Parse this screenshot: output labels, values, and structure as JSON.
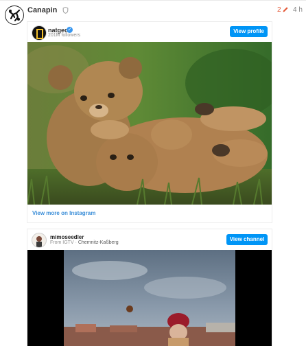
{
  "post": {
    "username": "Canapin",
    "edit_count": "2",
    "date": "4 h"
  },
  "embeds": [
    {
      "account": "natgeo",
      "followers": "201M followers",
      "action": "View profile",
      "footer_link": "View more on Instagram"
    },
    {
      "account": "mimoseedler",
      "from_label": "From IGTV",
      "location": "Chemnitz-Kaßberg",
      "action": "View channel"
    }
  ],
  "colors": {
    "accent_blue": "#0095f6",
    "link_blue": "#3b8ed8",
    "edit_orange": "#e45735"
  },
  "icons": [
    "shield-icon",
    "edit-pencil-icon",
    "verified-badge-icon"
  ]
}
